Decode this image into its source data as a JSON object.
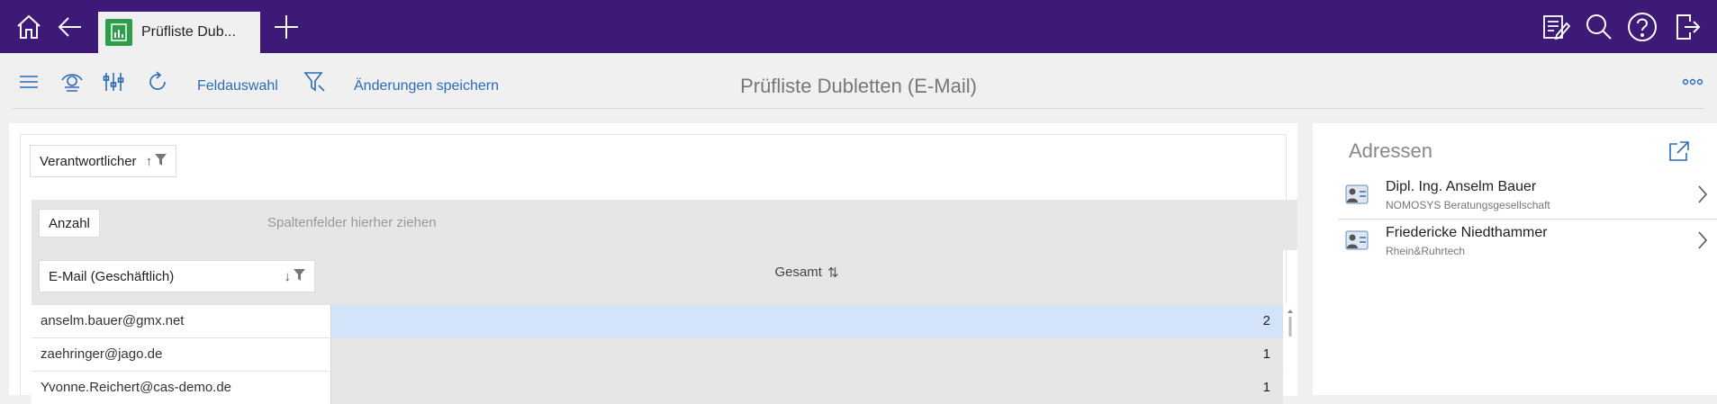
{
  "topbar": {
    "icons": [
      "home-icon",
      "back-icon",
      "add-tab-icon",
      "notes-icon",
      "search-icon",
      "help-icon",
      "logout-icon"
    ],
    "tab": {
      "title": "Prüfliste Dub...",
      "icon": "pivot-report-icon"
    },
    "color": "#3d1a78"
  },
  "toolbar": {
    "icons": [
      "menu-icon",
      "view-icon",
      "settings-sliders-icon",
      "refresh-icon",
      "filter-icon",
      "more-icon"
    ],
    "field_selection": "Feldauswahl",
    "save_changes": "Änderungen speichern",
    "page_title": "Prüfliste Dubletten (E-Mail)",
    "link_color": "#2b6cb8"
  },
  "pivot": {
    "filter_chip": "Verantwortlicher",
    "data_chip": "Anzahl",
    "column_placeholder": "Spaltenfelder hierher ziehen",
    "row_chip": "E-Mail (Geschäftlich)",
    "column_header": "Gesamt",
    "rows": [
      {
        "email": "anselm.bauer@gmx.net",
        "count": "2",
        "selected": true
      },
      {
        "email": "zaehringer@jago.de",
        "count": "1",
        "selected": false
      },
      {
        "email": "Yvonne.Reichert@cas-demo.de",
        "count": "1",
        "selected": false
      }
    ],
    "selected_color": "#d3e4fa"
  },
  "sidebar": {
    "title": "Adressen",
    "addresses": [
      {
        "name": "Dipl. Ing. Anselm Bauer",
        "company": "NOMOSYS Beratungsgesellschaft"
      },
      {
        "name": "Friedericke Niedthammer",
        "company": "Rhein&Ruhrtech"
      }
    ]
  }
}
